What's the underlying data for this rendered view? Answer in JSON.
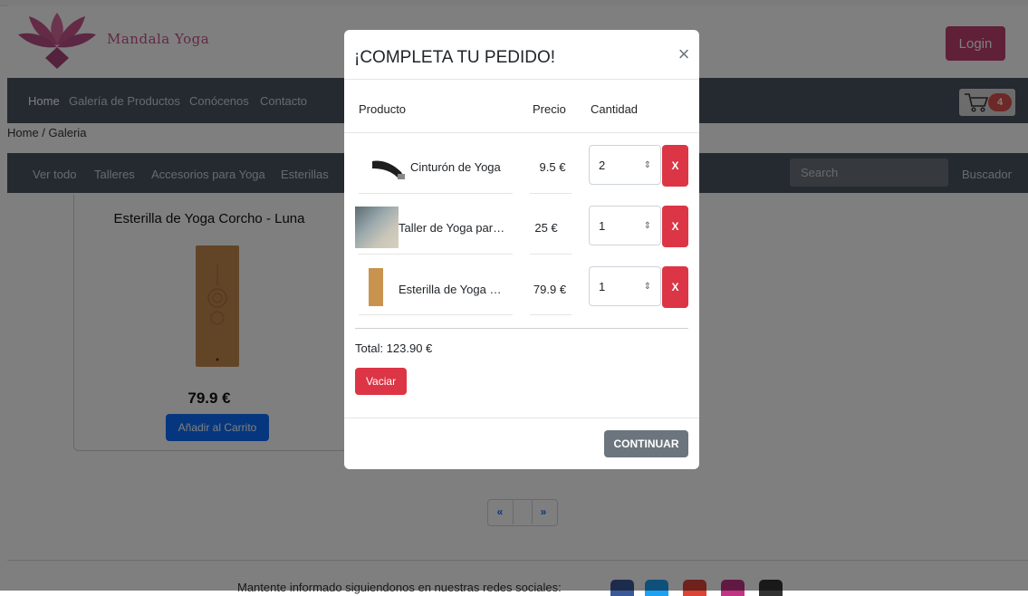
{
  "header": {
    "brand": "Mandala Yoga",
    "login_label": "Login"
  },
  "nav": {
    "items": [
      "Home",
      "Galería de Productos",
      "Conócenos",
      "Contacto"
    ],
    "cart_count": "4"
  },
  "breadcrumb": "Home / Galeria",
  "subnav": {
    "items": [
      "Ver todo",
      "Talleres",
      "Accesorios para Yoga",
      "Esterillas"
    ],
    "search_placeholder": "Search",
    "search_button": "Buscador"
  },
  "product_card": {
    "title": "Esterilla de Yoga Corcho - Luna",
    "price": "79.9 €",
    "add_label": "Añadir al Carrito"
  },
  "pagination": {
    "prev": "«",
    "next": "»"
  },
  "footer": {
    "text": "Mantente informado siguiendonos en nuestras redes sociales:"
  },
  "modal": {
    "title": "¡COMPLETA TU PEDIDO!",
    "headers": {
      "product": "Producto",
      "price": "Precio",
      "quantity": "Cantidad"
    },
    "items": [
      {
        "name": "Cinturón de Yoga",
        "price": "9.5 €",
        "qty": "2",
        "remove": "X"
      },
      {
        "name": "Taller de Yoga para ...",
        "price": "25 €",
        "qty": "1",
        "remove": "X"
      },
      {
        "name": "Esterilla de Yoga Co...",
        "price": "79.9 €",
        "qty": "1",
        "remove": "X"
      }
    ],
    "total": "Total: 123.90 €",
    "empty_label": "Vaciar",
    "continue_label": "CONTINUAR"
  },
  "colors": {
    "nav_bg": "#4b5563",
    "login": "#c0406e",
    "danger": "#dc3545",
    "primary": "#0d6efd",
    "secondary": "#6c757d"
  }
}
